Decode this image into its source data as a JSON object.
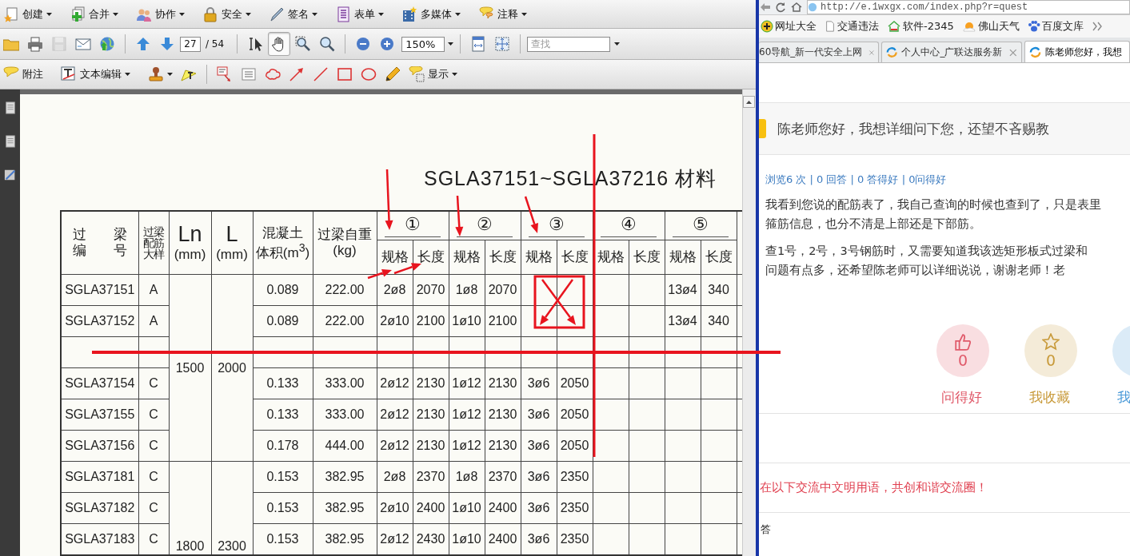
{
  "pdf_viewer": {
    "menu_buttons": [
      {
        "label": "创建"
      },
      {
        "label": "合并"
      },
      {
        "label": "协作"
      },
      {
        "label": "安全"
      },
      {
        "label": "签名"
      },
      {
        "label": "表单"
      },
      {
        "label": "多媒体"
      },
      {
        "label": "注释"
      }
    ],
    "save": {
      "disabled": true
    },
    "page_number": "27",
    "page_total": "/ 54",
    "tools": [
      {
        "kind": "select",
        "selected": false
      },
      {
        "kind": "hand",
        "selected": true
      },
      {
        "kind": "marquee-zoom",
        "selected": false
      },
      {
        "kind": "zoom",
        "selected": false
      }
    ],
    "zoom_value": "150%",
    "search_placeholder": "查找",
    "comment_buttons": [
      {
        "label": "附注"
      },
      {
        "label": "文本编辑"
      }
    ],
    "show_button": {
      "label": "显示"
    },
    "document": {
      "title": "SGLA37151~SGLA37216 材料",
      "columns": [
        {
          "kind": "text",
          "lines": [
            "过　　梁",
            "编　　号"
          ]
        },
        {
          "kind": "narrow",
          "lines": [
            "过梁",
            "配筋",
            "大样"
          ]
        },
        {
          "kind": "dimension",
          "lines": [
            "Ln",
            "(mm)"
          ]
        },
        {
          "kind": "dimension",
          "lines": [
            "L",
            "(mm)"
          ]
        },
        {
          "kind": "text",
          "lines": [
            "混凝土",
            "体积(m$^{3}$)"
          ]
        },
        {
          "kind": "text",
          "lines": [
            "过梁自重",
            "(kg)"
          ]
        }
      ],
      "groups": [
        {
          "label": "①",
          "columns": [
            "规格",
            "长度"
          ]
        },
        {
          "label": "②",
          "columns": [
            "规格",
            "长度"
          ]
        },
        {
          "label": "③",
          "columns": [
            "规格",
            "长度"
          ]
        },
        {
          "label": "④",
          "columns": [
            "规格",
            "长度"
          ]
        },
        {
          "label": "⑤",
          "columns": [
            "规格",
            "长度"
          ]
        }
      ],
      "rows": [
        {
          "kind": "data",
          "id": "SGLA37151",
          "detail": "A",
          "ln": "1500",
          "l": "2000",
          "volume": "0.089",
          "weight": "222.00",
          "bar_1": {
            "spec": "2ø8",
            "length": "2070"
          },
          "bar_2": {
            "spec": "1ø8",
            "length": "2070"
          },
          "bar_5": {
            "spec": "13ø4",
            "length": "340"
          }
        },
        {
          "kind": "data",
          "id": "SGLA37152",
          "detail": "A",
          "volume": "0.089",
          "weight": "222.00",
          "bar_1": {
            "spec": "2ø10",
            "length": "2100"
          },
          "bar_2": {
            "spec": "1ø10",
            "length": "2100"
          },
          "bar_5": {
            "spec": "13ø4",
            "length": "340"
          }
        },
        {
          "kind": "struck-through"
        },
        {
          "kind": "data",
          "id": "SGLA37154",
          "detail": "C",
          "volume": "0.133",
          "weight": "333.00",
          "bar_1": {
            "spec": "2ø12",
            "length": "2130"
          },
          "bar_2": {
            "spec": "1ø12",
            "length": "2130"
          },
          "bar_3": {
            "spec": "3ø6",
            "length": "2050"
          }
        },
        {
          "kind": "data",
          "id": "SGLA37155",
          "detail": "C",
          "volume": "0.133",
          "weight": "333.00",
          "bar_1": {
            "spec": "2ø12",
            "length": "2130"
          },
          "bar_2": {
            "spec": "1ø12",
            "length": "2130"
          },
          "bar_3": {
            "spec": "3ø6",
            "length": "2050"
          }
        },
        {
          "kind": "data",
          "id": "SGLA37156",
          "detail": "C",
          "volume": "0.178",
          "weight": "444.00",
          "bar_1": {
            "spec": "2ø12",
            "length": "2130"
          },
          "bar_2": {
            "spec": "1ø12",
            "length": "2130"
          },
          "bar_3": {
            "spec": "3ø6",
            "length": "2050"
          }
        },
        {
          "kind": "data",
          "id": "SGLA37181",
          "detail": "C",
          "ln": "1800",
          "l": "2300",
          "volume": "0.153",
          "weight": "382.95",
          "bar_1": {
            "spec": "2ø8",
            "length": "2370"
          },
          "bar_2": {
            "spec": "1ø8",
            "length": "2370"
          },
          "bar_3": {
            "spec": "3ø6",
            "length": "2350"
          }
        },
        {
          "kind": "data",
          "id": "SGLA37182",
          "detail": "C",
          "volume": "0.153",
          "weight": "382.95",
          "bar_1": {
            "spec": "2ø10",
            "length": "2400"
          },
          "bar_2": {
            "spec": "1ø10",
            "length": "2400"
          },
          "bar_3": {
            "spec": "3ø6",
            "length": "2350"
          }
        },
        {
          "kind": "data",
          "id": "SGLA37183",
          "detail": "C",
          "volume": "0.153",
          "weight": "382.95",
          "bar_1": {
            "spec": "2ø12",
            "length": "2430"
          },
          "bar_2": {
            "spec": "1ø10",
            "length": "2400"
          },
          "bar_3": {
            "spec": "3ø6",
            "length": "2350"
          }
        }
      ]
    }
  },
  "browser": {
    "url": "http://e.1wxgx.com/index.php?r=quest",
    "bookmarks": [
      {
        "label": "网址大全"
      },
      {
        "label": "交通违法"
      },
      {
        "label": "软件-2345"
      },
      {
        "label": "佛山天气"
      },
      {
        "label": "百度文库"
      }
    ],
    "tabs": [
      {
        "title": "60导航_新一代安全上网",
        "selected": false
      },
      {
        "title": "个人中心_广联达服务新",
        "selected": false
      },
      {
        "title": "陈老师您好，我想",
        "selected": true
      }
    ],
    "question": {
      "title": "陈老师您好，我想详细问下您，还望不吝赐教",
      "stats": "浏览6 次 | 0 回答 | 0 答得好 | 0问得好",
      "paragraphs": [
        [
          "我看到您说的配筋表了，我自己查询的时候也查到了，只是表里",
          "箍筋信息，也分不清是上部还是下部筋。"
        ],
        [
          "查1号，2号，3号钢筋时，又需要知道我该选矩形板式过梁和",
          "问题有点多，还希望陈老师可以详细说说，谢谢老师！老"
        ]
      ]
    },
    "actions": [
      {
        "kind": "like",
        "count": "0",
        "label": "问得好",
        "color": "#e05a6a"
      },
      {
        "kind": "favorite",
        "count": "0",
        "label": "我收藏",
        "color": "#c89a3a"
      },
      {
        "kind": "other",
        "label": "我",
        "color": "#4a9ad8"
      }
    ],
    "notice": "在以下交流中文明用语，共创和谐交流圈！",
    "answers_heading": "答"
  }
}
